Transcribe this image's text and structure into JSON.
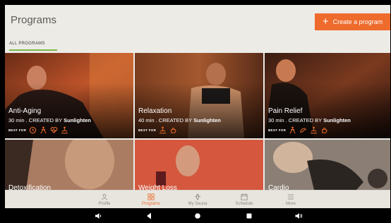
{
  "header": {
    "title": "Programs",
    "create_label": "Create a program"
  },
  "tabs": [
    {
      "label": "ALL PROGRAMS",
      "active": true
    }
  ],
  "programs": [
    {
      "title": "Anti-Aging",
      "duration": "30 min",
      "creator_prefix": ". CREATED BY",
      "creator": "Sunlighten",
      "best_for_label": "BEST FOR",
      "icons": [
        "clock-icon",
        "stretch-icon",
        "heart-pulse-icon",
        "meditation-icon"
      ]
    },
    {
      "title": "Relaxation",
      "duration": "40 min",
      "creator_prefix": ". CREATED BY",
      "creator": "Sunlighten",
      "best_for_label": "BEST FOR",
      "icons": [
        "meditation-icon",
        "hand-icon"
      ]
    },
    {
      "title": "Pain Relief",
      "duration": "30 min",
      "creator_prefix": ". CREATED BY",
      "creator": "Sunlighten",
      "best_for_label": "BEST FOR",
      "icons": [
        "stretch-icon",
        "muscle-icon",
        "meditation-icon",
        "hand-icon"
      ]
    },
    {
      "title": "Detoxification"
    },
    {
      "title": "Weight Loss"
    },
    {
      "title": "Cardio"
    }
  ],
  "bottom_nav": [
    {
      "label": "Profile",
      "icon": "user-icon",
      "active": false
    },
    {
      "label": "Programs",
      "icon": "grid-icon",
      "active": true
    },
    {
      "label": "My Sauna",
      "icon": "sauna-icon",
      "active": false
    },
    {
      "label": "Schedule",
      "icon": "calendar-icon",
      "active": false
    },
    {
      "label": "More",
      "icon": "menu-icon",
      "active": false
    }
  ],
  "colors": {
    "accent": "#ee6b2c",
    "tab_underline": "#79b84b",
    "background": "#ecebe6"
  }
}
